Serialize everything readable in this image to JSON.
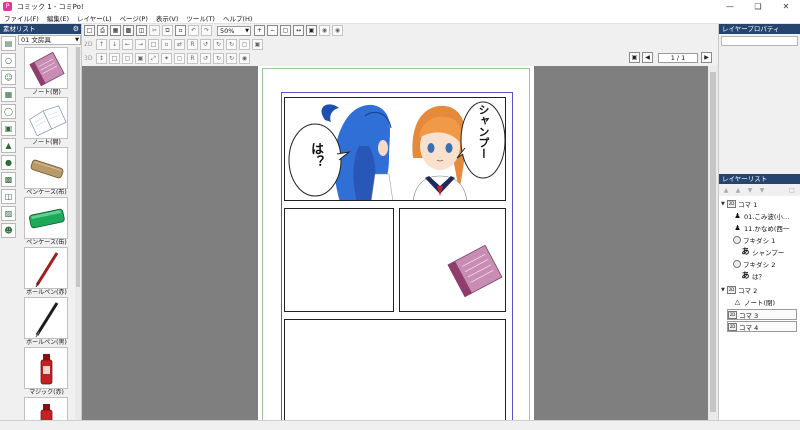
{
  "window": {
    "title": "コミック 1 - コミPo!",
    "app_icon": "P"
  },
  "menu": [
    "ファイル(F)",
    "編集(E)",
    "レイヤー(L)",
    "ページ(P)",
    "表示(V)",
    "ツール(T)",
    "ヘルプ(H)"
  ],
  "material_panel": {
    "title": "素材リスト",
    "category": "01 文房具",
    "categories": [
      "frame-icon",
      "speech-bubble-icon",
      "character-icon",
      "book-icon",
      "balloon-icon",
      "photo-icon",
      "tree-icon",
      "drop-icon",
      "background-icon",
      "screen-icon",
      "landscape-icon",
      "face-icon"
    ],
    "items": [
      {
        "label": "ノート(閉)"
      },
      {
        "label": "ノート(開)"
      },
      {
        "label": "ペンケース(布)"
      },
      {
        "label": "ペンケース(缶)"
      },
      {
        "label": "ボールペン(赤)"
      },
      {
        "label": "ボールペン(黒)"
      },
      {
        "label": "マジック(赤)"
      },
      {
        "label": ""
      }
    ]
  },
  "toolbar": {
    "zoom": "50%",
    "page_counter": "1 / 1",
    "row_labels": [
      "2D",
      "3D"
    ]
  },
  "comic": {
    "bubble_left": "は？",
    "bubble_right": "シャンプー"
  },
  "property_panel": {
    "title": "レイヤープロパティ"
  },
  "layer_panel": {
    "title": "レイヤーリスト",
    "layers": [
      {
        "name": "コマ 1",
        "icon": "frame-icon",
        "level": 0,
        "expanded": true
      },
      {
        "name": "01.こみ波(小…",
        "icon": "character-icon",
        "level": 1
      },
      {
        "name": "11.かなめ(西一",
        "icon": "character-icon",
        "level": 1
      },
      {
        "name": "フキダシ 1",
        "icon": "balloon-icon",
        "level": 1
      },
      {
        "name": "シャンプー",
        "icon": "text-icon",
        "level": 2
      },
      {
        "name": "フキダシ 2",
        "icon": "balloon-icon",
        "level": 1
      },
      {
        "name": "は？",
        "icon": "text-icon",
        "level": 2
      },
      {
        "name": "コマ 2",
        "icon": "frame-icon",
        "level": 0,
        "expanded": true
      },
      {
        "name": "ノート(閉)",
        "icon": "object-icon",
        "level": 1
      },
      {
        "name": "コマ 3",
        "icon": "frame-icon",
        "level": 0
      },
      {
        "name": "コマ 4",
        "icon": "frame-icon",
        "level": 0
      }
    ]
  },
  "colors": {
    "panel_header": "#26456e",
    "canvas_bg": "#7f7f7f",
    "accent": "#e0389a"
  }
}
